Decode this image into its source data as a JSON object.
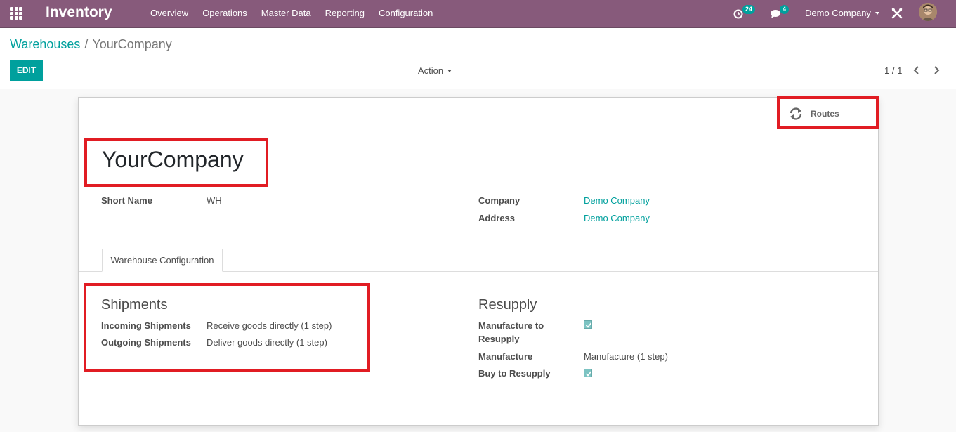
{
  "navbar": {
    "app_name": "Inventory",
    "menu": [
      "Overview",
      "Operations",
      "Master Data",
      "Reporting",
      "Configuration"
    ],
    "activity_count": "24",
    "messages_count": "4",
    "company": "Demo Company",
    "accent_color": "#875a7b",
    "badge_color": "#00a09d"
  },
  "breadcrumb": {
    "parent": "Warehouses",
    "separator": "/",
    "current": "YourCompany"
  },
  "control_panel": {
    "edit_label": "EDIT",
    "action_label": "Action",
    "pager": "1 / 1"
  },
  "form": {
    "button_box": {
      "routes_label": "Routes"
    },
    "title": "YourCompany",
    "fields": {
      "short_name_label": "Short Name",
      "short_name_value": "WH",
      "company_label": "Company",
      "company_value": "Demo Company",
      "address_label": "Address",
      "address_value": "Demo Company"
    },
    "tab_label": "Warehouse Configuration",
    "shipments": {
      "title": "Shipments",
      "incoming_label": "Incoming Shipments",
      "incoming_value": "Receive goods directly (1 step)",
      "outgoing_label": "Outgoing Shipments",
      "outgoing_value": "Deliver goods directly (1 step)"
    },
    "resupply": {
      "title": "Resupply",
      "manufacture_to_resupply_label_1": "Manufacture to",
      "manufacture_to_resupply_label_2": "Resupply",
      "manufacture_to_resupply_checked": true,
      "manufacture_label": "Manufacture",
      "manufacture_value": "Manufacture (1 step)",
      "buy_to_resupply_label": "Buy to Resupply",
      "buy_to_resupply_checked": true
    }
  },
  "highlight_color": "#e11c23"
}
